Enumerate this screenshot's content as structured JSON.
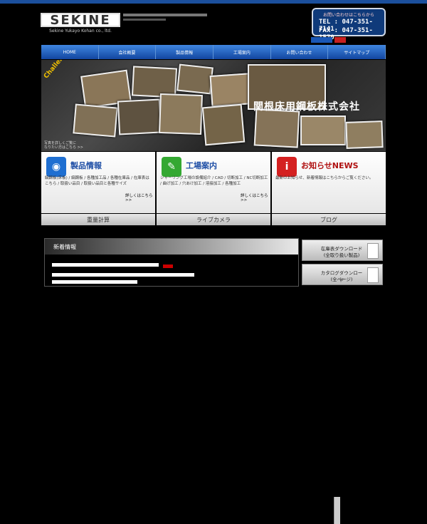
{
  "header": {
    "logo_text": "SEKINE",
    "logo_sub": "Sekine Yukayo Kohan co., ltd.",
    "contact": {
      "inquiry": "お問い合わせはこちらから",
      "tel": "TEL : 047-351-7141",
      "fax": "FAX : 047-351-1570"
    }
  },
  "nav": {
    "items": [
      "HOME",
      "会社概要",
      "製品情報",
      "工場案内",
      "お問い合わせ",
      "サイトマップ"
    ]
  },
  "hero": {
    "title": "関根床用鋼板株式会社",
    "badge": "Challenge and Evolution",
    "caption_line1": "写真を詳しくご覧に",
    "caption_line2": "なりたい方はこちら >>"
  },
  "columns": [
    {
      "title": "製品情報",
      "icon": "disc-icon",
      "icon_color": "#1f6fd1",
      "title_class": "",
      "desc": "縞鋼板(床板) / 縞鋼板 / 各種加工品 / 各種在庫品 / 在庫表はこちら / 取扱い品目 / 取扱い品目と各種サイズ",
      "more": "詳しくはこちら >>"
    },
    {
      "title": "工場案内",
      "icon": "clipboard-icon",
      "icon_color": "#34a832",
      "title_class": "",
      "desc": "シャーリング工場の設備紹介 / CAD / 切断加工 / NC切断加工 / 曲げ加工 / 穴あけ加工 / 溶接加工 / 各種加工",
      "more": "詳しくはこちら >>"
    },
    {
      "title": "お知らせNEWS",
      "icon": "info-icon",
      "icon_color": "#d42020",
      "title_class": "red",
      "desc": "最新のお知らせ、新着情報はこちらからご覧ください。",
      "more": ""
    }
  ],
  "bottom_buttons": [
    "重量計算",
    "ライブカメラ",
    "ブログ"
  ],
  "news": {
    "heading": "新着情報"
  },
  "side_buttons": [
    {
      "line1": "在庫表ダウンロード",
      "line2": "(全取り扱い製品)"
    },
    {
      "line1": "カタログダウンロード",
      "line2": "(全ページ)"
    }
  ]
}
